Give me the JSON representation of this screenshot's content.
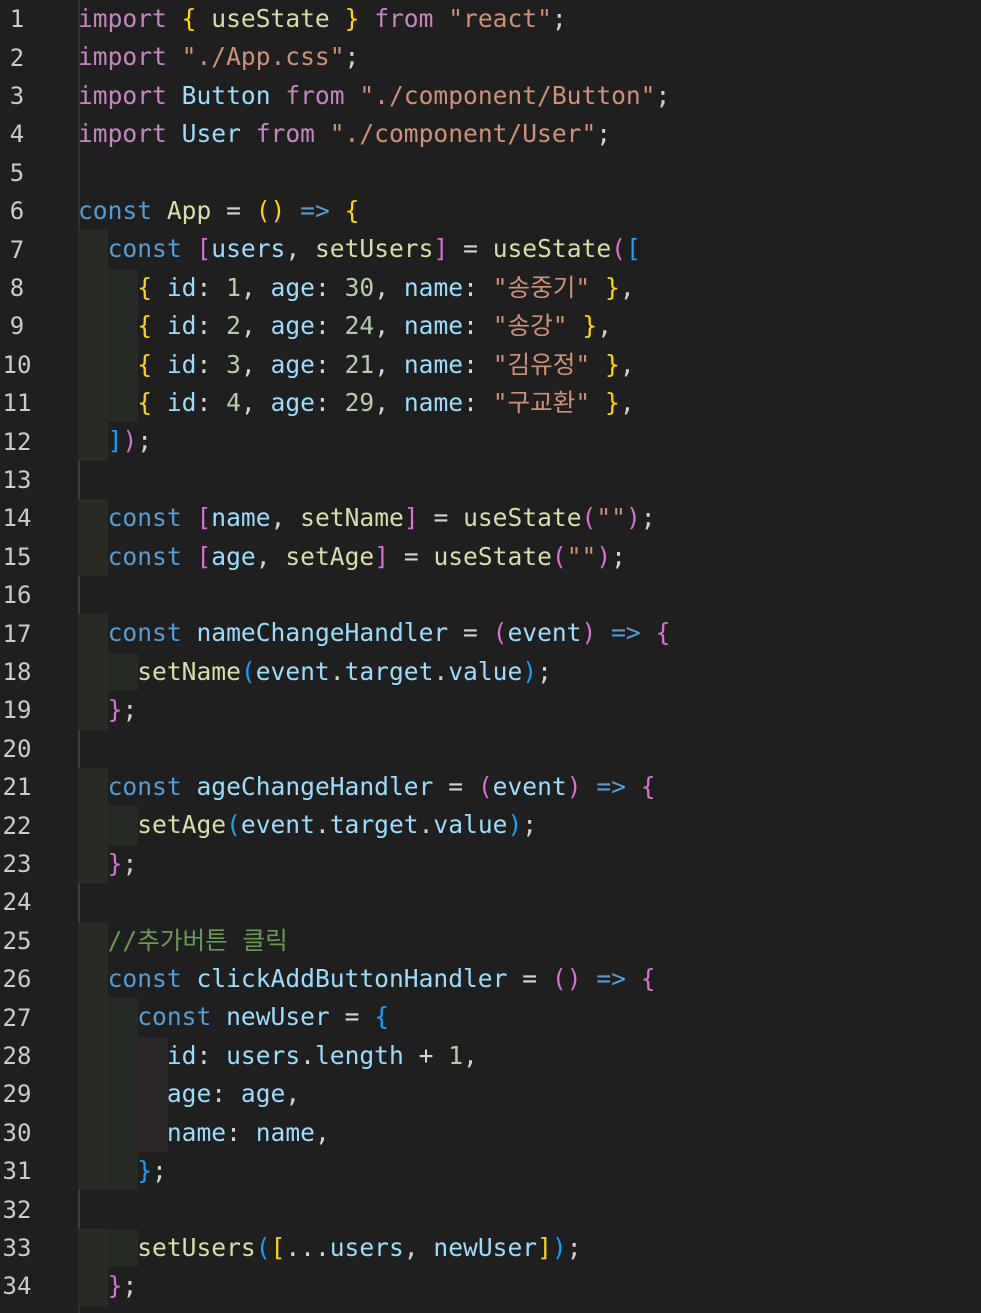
{
  "editor": {
    "language": "javascript",
    "theme_colors": {
      "background": "#1f1f1f",
      "line_number": "#cccccc",
      "keyword_control": "#c586c0",
      "keyword_storage": "#569cd6",
      "function": "#dcdcaa",
      "variable": "#9cdcfe",
      "constant": "#4fc1ff",
      "string": "#ce9178",
      "number": "#b5cea8",
      "comment": "#6a9955",
      "bracket_1": "#ffd700",
      "bracket_2": "#da70d6",
      "bracket_3": "#179fff"
    },
    "lines": [
      {
        "n": "1",
        "text": "import { useState } from \"react\";"
      },
      {
        "n": "2",
        "text": "import \"./App.css\";"
      },
      {
        "n": "3",
        "text": "import Button from \"./component/Button\";"
      },
      {
        "n": "4",
        "text": "import User from \"./component/User\";"
      },
      {
        "n": "5",
        "text": ""
      },
      {
        "n": "6",
        "text": "const App = () => {"
      },
      {
        "n": "7",
        "text": "  const [users, setUsers] = useState(["
      },
      {
        "n": "8",
        "text": "    { id: 1, age: 30, name: \"송중기\" },"
      },
      {
        "n": "9",
        "text": "    { id: 2, age: 24, name: \"송강\" },"
      },
      {
        "n": "10",
        "text": "    { id: 3, age: 21, name: \"김유정\" },"
      },
      {
        "n": "11",
        "text": "    { id: 4, age: 29, name: \"구교환\" },"
      },
      {
        "n": "12",
        "text": "  ]);"
      },
      {
        "n": "13",
        "text": ""
      },
      {
        "n": "14",
        "text": "  const [name, setName] = useState(\"\");"
      },
      {
        "n": "15",
        "text": "  const [age, setAge] = useState(\"\");"
      },
      {
        "n": "16",
        "text": ""
      },
      {
        "n": "17",
        "text": "  const nameChangeHandler = (event) => {"
      },
      {
        "n": "18",
        "text": "    setName(event.target.value);"
      },
      {
        "n": "19",
        "text": "  };"
      },
      {
        "n": "20",
        "text": ""
      },
      {
        "n": "21",
        "text": "  const ageChangeHandler = (event) => {"
      },
      {
        "n": "22",
        "text": "    setAge(event.target.value);"
      },
      {
        "n": "23",
        "text": "  };"
      },
      {
        "n": "24",
        "text": ""
      },
      {
        "n": "25",
        "text": "  //추가버튼 클릭"
      },
      {
        "n": "26",
        "text": "  const clickAddButtonHandler = () => {"
      },
      {
        "n": "27",
        "text": "    const newUser = {"
      },
      {
        "n": "28",
        "text": "      id: users.length + 1,"
      },
      {
        "n": "29",
        "text": "      age: age,"
      },
      {
        "n": "30",
        "text": "      name: name,"
      },
      {
        "n": "31",
        "text": "    };"
      },
      {
        "n": "32",
        "text": ""
      },
      {
        "n": "33",
        "text": "    setUsers([...users, newUser]);"
      },
      {
        "n": "34",
        "text": "  };"
      }
    ]
  }
}
